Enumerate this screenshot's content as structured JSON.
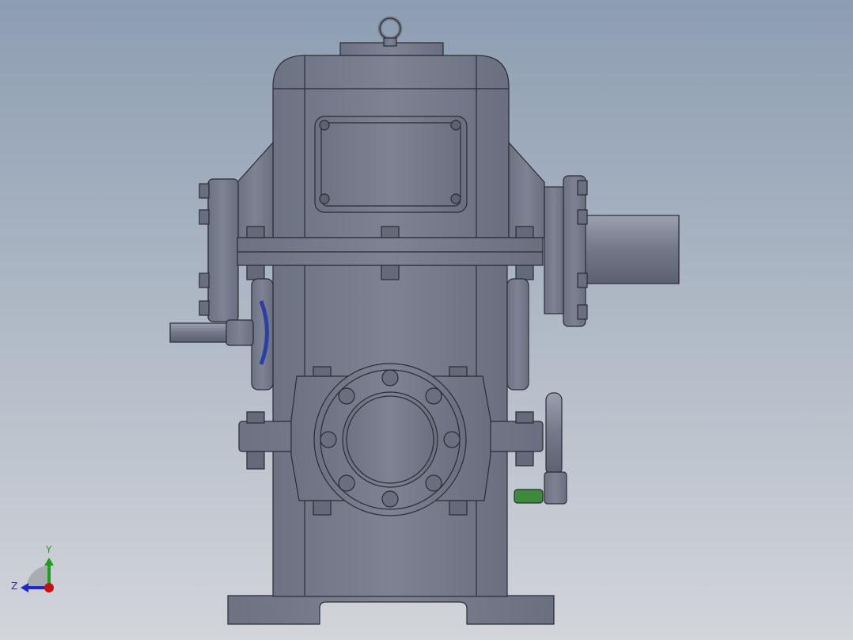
{
  "viewport": {
    "model": "worm-gear-reducer",
    "view": "front"
  },
  "triad": {
    "y_label": "Y",
    "z_label": "Z"
  },
  "colors": {
    "body": "#777c8c",
    "edge": "#2a2c33",
    "fitting": "#3d8a3a",
    "seal": "#2c3ea8",
    "triad_y": "#1aa01a",
    "triad_z": "#1a2ad0",
    "triad_x": "#c81010"
  }
}
